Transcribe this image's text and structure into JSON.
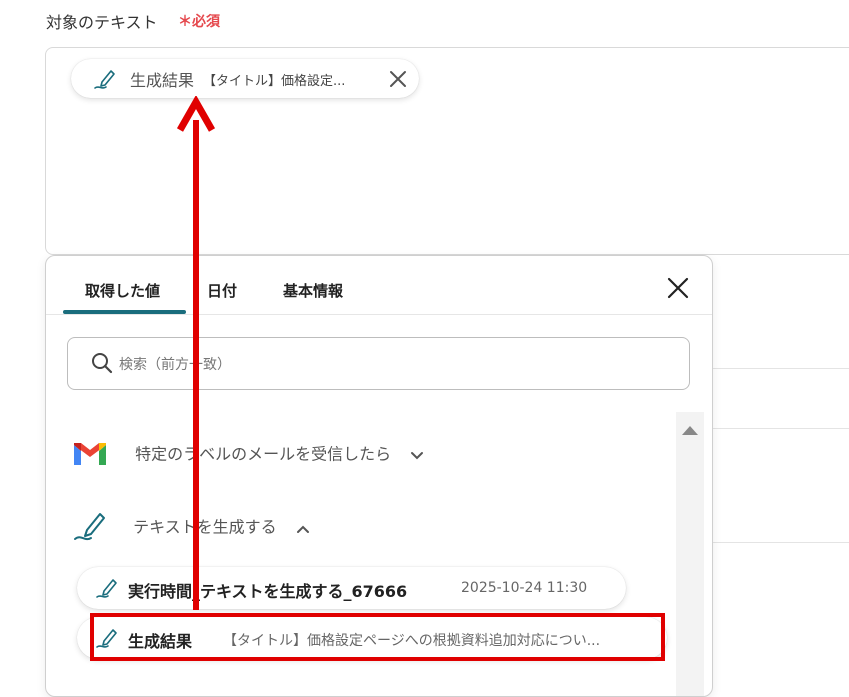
{
  "field": {
    "label": "対象のテキスト",
    "required": "＊必須"
  },
  "chip": {
    "title": "生成結果",
    "subtitle": "【タイトル】価格設定..."
  },
  "popup": {
    "tabs": [
      {
        "label": "取得した値",
        "active": true
      },
      {
        "label": "日付",
        "active": false
      },
      {
        "label": "基本情報",
        "active": false
      }
    ],
    "search": {
      "placeholder": "検索（前方一致）"
    },
    "sections": [
      {
        "label": "特定のラベルのメールを受信したら",
        "expanded": false,
        "icon": "gmail-icon"
      },
      {
        "label": "テキストを生成する",
        "expanded": true,
        "icon": "pen-icon"
      }
    ],
    "items": [
      {
        "title": "実行時間_テキストを生成する_67666",
        "meta": "2025-10-24 11:30"
      },
      {
        "title": "生成結果",
        "meta": "【タイトル】価格設定ページへの根拠資料追加対応につい..."
      }
    ]
  },
  "colors": {
    "accent": "#1a6d7d",
    "required": "#e5484d",
    "annotation": "#e00000"
  }
}
